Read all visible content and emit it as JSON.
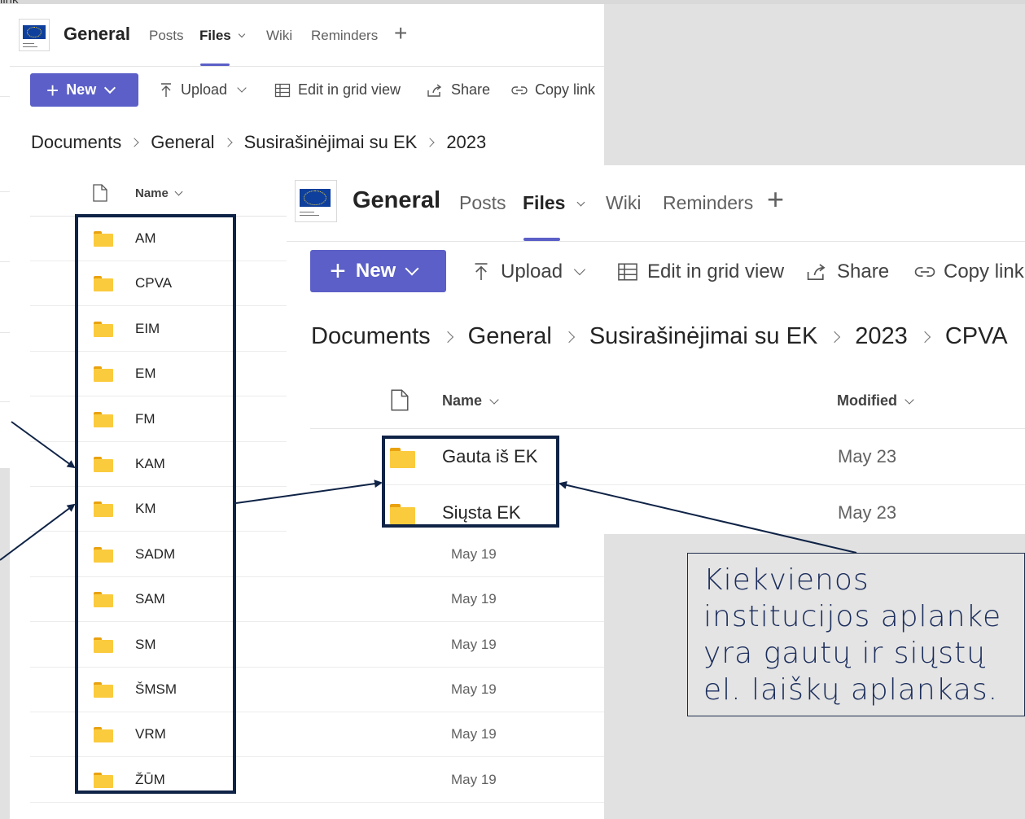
{
  "back_window": {
    "team_name": "General",
    "tabs": [
      {
        "label": "Posts"
      },
      {
        "label": "Files"
      },
      {
        "label": "Wiki"
      },
      {
        "label": "Reminders"
      }
    ],
    "toolbar": {
      "new_label": "New",
      "upload_label": "Upload",
      "grid_label": "Edit in grid view",
      "share_label": "Share",
      "copy_link_label": "Copy link"
    },
    "breadcrumb": [
      "Documents",
      "General",
      "Susirašinėjimai su EK",
      "2023"
    ],
    "column_name": "Name",
    "folders": [
      "AM",
      "CPVA",
      "EIM",
      "EM",
      "FM",
      "KAM",
      "KM",
      "SADM",
      "SAM",
      "SM",
      "ŠMSM",
      "VRM",
      "ŽŪM"
    ],
    "dates": [
      "May 19",
      "May 19",
      "May 19",
      "May 19",
      "May 19",
      "May 19"
    ]
  },
  "front_window": {
    "team_name": "General",
    "tabs": [
      {
        "label": "Posts"
      },
      {
        "label": "Files"
      },
      {
        "label": "Wiki"
      },
      {
        "label": "Reminders"
      }
    ],
    "toolbar": {
      "new_label": "New",
      "upload_label": "Upload",
      "grid_label": "Edit in grid view",
      "share_label": "Share",
      "copy_link_label": "Copy link"
    },
    "breadcrumb": [
      "Documents",
      "General",
      "Susirašinėjimai su EK",
      "2023",
      "CPVA"
    ],
    "column_name": "Name",
    "column_modified": "Modified",
    "rows": [
      {
        "name": "Gauta iš EK",
        "modified": "May 23"
      },
      {
        "name": "Siųsta EK",
        "modified": "May 23"
      }
    ]
  },
  "callout_lines": [
    "Kiekvienos",
    "institucijos aplanke",
    "yra gautų ir siųstų",
    "el. laiškų aplankas."
  ],
  "cut_text": "link",
  "colors": {
    "accent": "#5b5fc7",
    "highlight": "#0f2346",
    "callout_text": "#1b2d5c",
    "folder": "#fbcb3e"
  }
}
